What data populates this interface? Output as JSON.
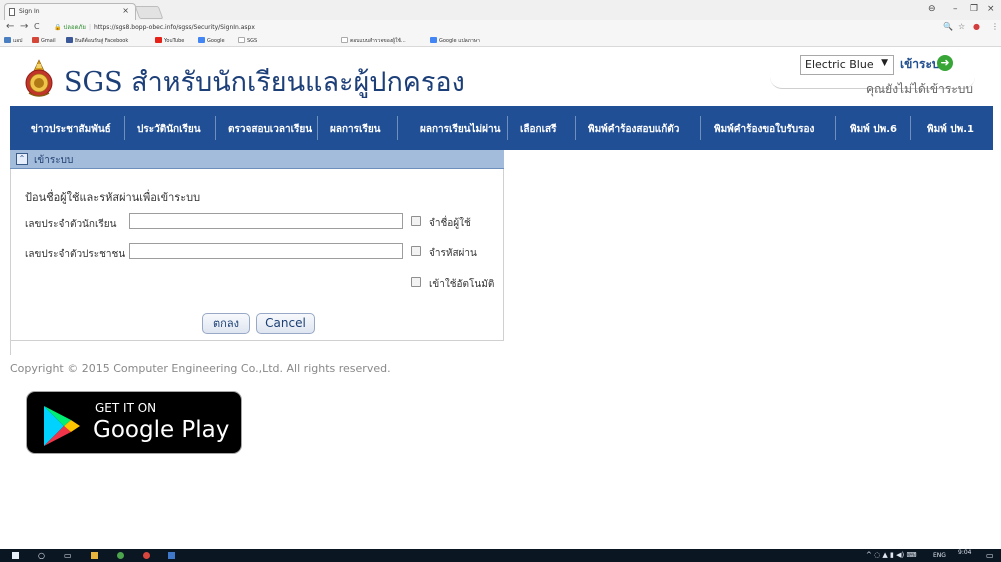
{
  "browser": {
    "tab_title": "Sign In",
    "tab_close": "×",
    "window_controls": {
      "user": "⊖",
      "minimize": "–",
      "restore": "❐",
      "close": "×"
    },
    "url_secure_label": "ปลอดภัย",
    "url": "https://sgs8.bopp-obec.info/sgss/Security/SignIn.aspx",
    "nav": {
      "back": "←",
      "forward": "→",
      "reload": "C"
    },
    "right_icons": [
      "zoom-icon",
      "star-icon",
      "extension-icon",
      "menu-icon"
    ],
    "bookmarks": [
      {
        "label": "แอป",
        "color": "#4a7fc1"
      },
      {
        "label": "Gmail",
        "color": "#d44638"
      },
      {
        "label": "ยินดีต้อนรับสู่ Facebook",
        "color": "#3b5998"
      },
      {
        "label": "YouTube",
        "color": "#e62117"
      },
      {
        "label": "Google",
        "color": "#4285f4"
      },
      {
        "label": "SGS",
        "color": "#aaaaaa"
      },
      {
        "label": "ตอบแบบสำรวจของผู้ใช้...",
        "color": "#aaaaaa"
      },
      {
        "label": "Google แปลภาษา",
        "color": "#4285f4"
      }
    ]
  },
  "header": {
    "site_title": "SGS สำหรับนักเรียนและผู้ปกครอง",
    "theme_selected": "Electric Blue",
    "theme_arrow": "▼",
    "login_link": "เข้าระบบ",
    "login_status": "คุณยังไม่ได้เข้าระบบ"
  },
  "nav_items": [
    "ข่าวประชาสัมพันธ์",
    "ประวัตินักเรียน",
    "ตรวจสอบเวลาเรียน",
    "ผลการเรียน",
    "ผลการเรียนไม่ผ่าน",
    "เลือกเสรี",
    "พิมพ์คำร้องสอบแก้ตัว",
    "พิมพ์คำร้องขอใบรับรอง",
    "พิมพ์ ปพ.6",
    "พิมพ์ ปพ.1"
  ],
  "login": {
    "panel_title": "เข้าระบบ",
    "collapse_glyph": "⌃",
    "instruction": "ป้อนชื่อผู้ใช้และรหัสผ่านเพื่อเข้าระบบ",
    "student_id_label": "เลขประจำตัวนักเรียน",
    "student_id_value": "",
    "citizen_id_label": "เลขประจำตัวประชาชน",
    "citizen_id_value": "",
    "remember_user_label": "จำชื่อผู้ใช้",
    "remember_password_label": "จำรหัสผ่าน",
    "auto_login_label": "เข้าใช้อัตโนมัติ",
    "submit_label": "ตกลง",
    "cancel_label": "Cancel"
  },
  "footer": {
    "copyright": "Copyright © 2015 Computer Engineering Co.,Ltd. All rights reserved.",
    "store_badge_top": "GET IT ON",
    "store_badge_name": "Google Play"
  },
  "taskbar": {
    "language": "ENG",
    "time": "9:04",
    "tray_text": "^ ◌ ▲ ▮ ◀) ⌨"
  },
  "colors": {
    "nav_bg": "#214f95",
    "title_blue": "#1d3f78",
    "panel_header": "#a4bcdc"
  }
}
